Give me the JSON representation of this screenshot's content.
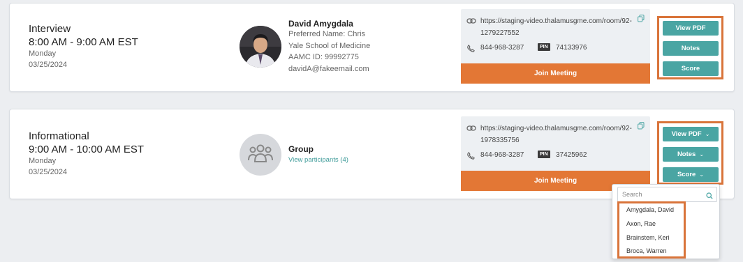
{
  "colors": {
    "accent_teal": "#4aa5a3",
    "join_orange": "#e37735",
    "highlight_border": "#d9743a",
    "page_bg": "#eceef1"
  },
  "card1": {
    "type": "Interview",
    "time": "8:00 AM - 9:00 AM EST",
    "day": "Monday",
    "date": "03/25/2024",
    "participant": {
      "name": "David Amygdala",
      "preferred_name": "Preferred Name: Chris",
      "school": "Yale School of Medicine",
      "aamc_id": "AAMC ID: 99992775",
      "email": "davidA@fakeemail.com"
    },
    "meeting": {
      "url": "https://staging-video.thalamusgme.com/room/92-1279227552",
      "phone": "844-968-3287",
      "pin_label": "PIN",
      "pin": "74133976",
      "join_label": "Join Meeting"
    },
    "buttons": {
      "view_pdf": "View PDF",
      "notes": "Notes",
      "score": "Score"
    }
  },
  "card2": {
    "type": "Informational",
    "time": "9:00 AM - 10:00 AM EST",
    "day": "Monday",
    "date": "03/25/2024",
    "group": {
      "label": "Group",
      "view_participants": "View participants (4)"
    },
    "meeting": {
      "url": "https://staging-video.thalamusgme.com/room/92-1978335756",
      "phone": "844-968-3287",
      "pin_label": "PIN",
      "pin": "37425962",
      "join_label": "Join Meeting"
    },
    "buttons": {
      "view_pdf": "View PDF",
      "notes": "Notes",
      "score": "Score"
    }
  },
  "dropdown": {
    "search_placeholder": "Search",
    "items": [
      "Amygdala, David",
      "Axon, Rae",
      "Brainstem, Keri",
      "Broca, Warren"
    ]
  },
  "icons": {
    "link": "link-icon",
    "copy": "copy-icon",
    "phone": "phone-icon",
    "group": "group-icon",
    "search": "search-icon",
    "chevron": "chevron-down-icon"
  }
}
